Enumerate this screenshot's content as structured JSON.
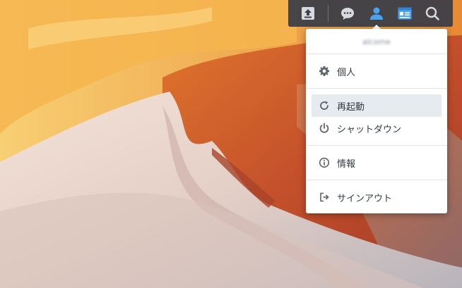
{
  "taskbar": {
    "icons": [
      "upload-icon",
      "chat-icon",
      "user-icon",
      "widgets-icon",
      "search-icon"
    ],
    "accent": "#4aa3f0"
  },
  "menu": {
    "username": "alcome",
    "items": [
      {
        "label": "個人",
        "icon": "gear-icon"
      },
      {
        "label": "再起動",
        "icon": "restart-icon"
      },
      {
        "label": "シャットダウン",
        "icon": "power-icon"
      },
      {
        "label": "情報",
        "icon": "info-icon"
      },
      {
        "label": "サインアウト",
        "icon": "sign-out-icon"
      }
    ],
    "highlighted": "再起動"
  }
}
